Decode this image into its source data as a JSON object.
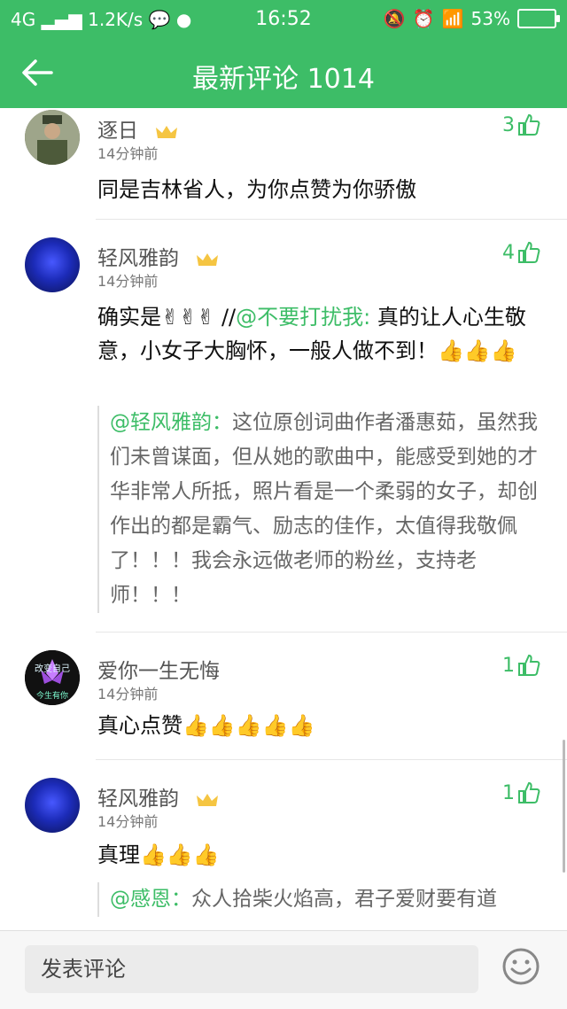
{
  "status_bar": {
    "network": "4G",
    "speed": "1.2K/s",
    "time": "16:52",
    "battery": "53%"
  },
  "header": {
    "title": "最新评论 1014"
  },
  "comments": [
    {
      "user": "逐日",
      "time": "14分钟前",
      "likes": "3",
      "text": "同是吉林省人，为你点赞为你骄傲"
    },
    {
      "user": "轻风雅韵",
      "time": "14分钟前",
      "likes": "4",
      "text_prefix": "确实是✌✌✌ //",
      "mention": "@不要打扰我:",
      "text_rest": "真的让人心生敬意，小女子大胸怀，一般人做不到！👍👍👍",
      "quote_mention": "@轻风雅韵：",
      "quote_text": "这位原创词曲作者潘惠茹，虽然我们未曾谋面，但从她的歌曲中，能感受到她的才华非常人所抵，照片看是一个柔弱的女子，却创作出的都是霸气、励志的佳作，太值得我敬佩了！！！我会永远做老师的粉丝，支持老师！！！"
    },
    {
      "user": "爱你一生无悔",
      "time": "14分钟前",
      "likes": "1",
      "text": "真心点赞👍👍👍👍👍",
      "avatar_text_top": "改变自己",
      "avatar_text_bottom": "今生有你"
    },
    {
      "user": "轻风雅韵",
      "time": "14分钟前",
      "likes": "1",
      "text": "真理👍👍👍",
      "quote_mention": "@感恩：",
      "quote_text": "众人拾柴火焰高，君子爱财要有道"
    }
  ],
  "footer": {
    "input_placeholder": "发表评论"
  },
  "colors": {
    "accent": "#3dbd67",
    "mention": "#3dbd67"
  }
}
